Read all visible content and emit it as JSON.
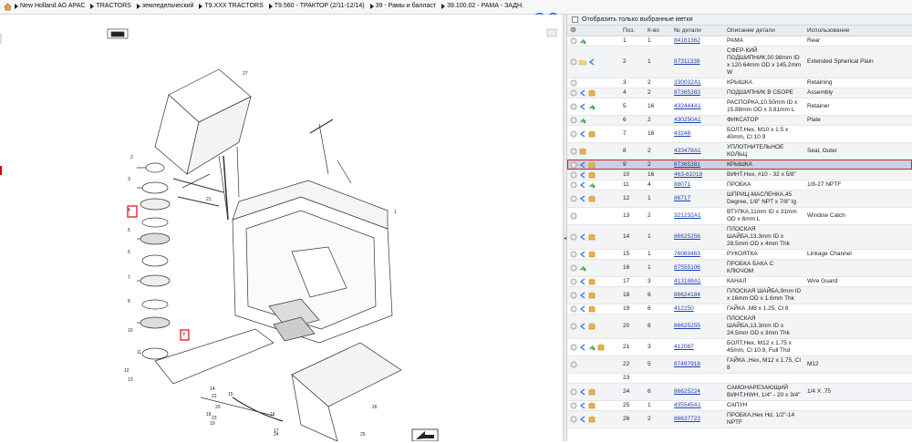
{
  "breadcrumbs": [
    "New Holland AG APAC",
    "TRACTORS",
    "земледельческий",
    "T9.XXX TRACTORS",
    "T9.560 - ТРАКТОР (2/11-12/14)",
    "39 - Рамы и балласт",
    "39.100.02 - РАМА - ЗАДН."
  ],
  "filter_label": "Отобразить только выбранные метки",
  "columns": {
    "pos": "Поз.",
    "qty": "К-во",
    "part": "№ детали",
    "desc": "Описание детали",
    "usage": "Использование"
  },
  "rows": [
    {
      "pos": "1",
      "qty": "1",
      "part": "84181362",
      "desc": "РАМА",
      "usage": "Rear",
      "icons": [
        "circle",
        "arrow"
      ]
    },
    {
      "pos": "2",
      "qty": "1",
      "part": "87311338",
      "desc": "СФЕР-КИЙ ПОДШИПНИК,50.98mm ID x 120.64mm OD x 145.2mm W",
      "usage": "Extended Spherical Plain",
      "icons": [
        "circle",
        "folder",
        "swap"
      ]
    },
    {
      "pos": "3",
      "qty": "2",
      "part": "330032A1",
      "desc": "КРЫШКА",
      "usage": "Retaining",
      "icons": [
        "circle"
      ]
    },
    {
      "pos": "4",
      "qty": "2",
      "part": "87365383",
      "desc": "ПОДШИПНИК В СБОРЕ",
      "usage": "Assembly",
      "icons": [
        "circle",
        "swap",
        "box"
      ]
    },
    {
      "pos": "5",
      "qty": "16",
      "part": "432444A1",
      "desc": "РАСПОРКА,10.50mm ID x 15.88mm OD x 3.81mm L",
      "usage": "Retainer",
      "icons": [
        "circle",
        "swap",
        "arrow"
      ]
    },
    {
      "pos": "6",
      "qty": "2",
      "part": "430250A1",
      "desc": "ФИКСАТОР",
      "usage": "Plate",
      "icons": [
        "circle",
        "arrow"
      ]
    },
    {
      "pos": "7",
      "qty": "16",
      "part": "43248",
      "desc": "БОЛТ,Hex, M10 x 1.5 x 40mm, Cl 10.9",
      "usage": "",
      "icons": [
        "circle",
        "swap",
        "box"
      ]
    },
    {
      "pos": "8",
      "qty": "2",
      "part": "433478A1",
      "desc": "УПЛОТНИТЕЛЬНОЕ КОЛЬЦ",
      "usage": "Seal, Outer",
      "icons": [
        "circle",
        "box"
      ]
    },
    {
      "pos": "9",
      "qty": "2",
      "part": "87365381",
      "desc": "КРЫШКА",
      "usage": "",
      "icons": [
        "circle",
        "swap",
        "box"
      ],
      "selected": true
    },
    {
      "pos": "10",
      "qty": "16",
      "part": "463-61018",
      "desc": "ВИНТ,Hex, #10 - 32 x 5/8\"",
      "usage": "",
      "icons": [
        "circle",
        "swap",
        "box"
      ]
    },
    {
      "pos": "11",
      "qty": "4",
      "part": "88071",
      "desc": "ПРОБКА",
      "usage": "1/8-27 NPTF",
      "icons": [
        "circle",
        "swap",
        "arrow"
      ]
    },
    {
      "pos": "12",
      "qty": "1",
      "part": "86717",
      "desc": "ШПРИЦ-МАСЛЕНКА,45 Degree, 1/8\" NPT x 7/8\" lg",
      "usage": "",
      "icons": [
        "circle",
        "swap",
        "box"
      ]
    },
    {
      "pos": "13",
      "qty": "2",
      "part": "321232A1",
      "desc": "ВТУЛКА,11mm ID x 31mm OD x 6mm L",
      "usage": "Window Catch",
      "icons": [
        "circle"
      ]
    },
    {
      "pos": "14",
      "qty": "1",
      "part": "86625256",
      "desc": "ПЛОСКАЯ ШАЙБА,13.3mm ID x 28.5mm OD x 4mm Thk",
      "usage": "",
      "icons": [
        "circle",
        "swap",
        "box"
      ]
    },
    {
      "pos": "15",
      "qty": "1",
      "part": "76083463",
      "desc": "РУКОЯТКА",
      "usage": "Linkage Channel",
      "icons": [
        "circle",
        "swap",
        "box"
      ]
    },
    {
      "pos": "16",
      "qty": "1",
      "part": "87555106",
      "desc": "ПРОБКА БАКА С КЛЮЧОМ",
      "usage": "",
      "icons": [
        "circle",
        "arrow"
      ]
    },
    {
      "pos": "17",
      "qty": "3",
      "part": "413188A1",
      "desc": "КАНАЛ",
      "usage": "Wire Guard",
      "icons": [
        "circle",
        "swap",
        "box"
      ]
    },
    {
      "pos": "18",
      "qty": "6",
      "part": "86624184",
      "desc": "ПЛОСКАЯ ШАЙБА,9mm ID x 16mm OD x 1.6mm Thk",
      "usage": "",
      "icons": [
        "circle",
        "swap",
        "box"
      ]
    },
    {
      "pos": "19",
      "qty": "6",
      "part": "412250",
      "desc": "ГАЙКА ,M8 x 1.25, Cl 8",
      "usage": "",
      "icons": [
        "circle",
        "swap",
        "box"
      ]
    },
    {
      "pos": "20",
      "qty": "8",
      "part": "86625255",
      "desc": "ПЛОСКАЯ ШАЙБА,13.3mm ID x 24.5mm OD x 3mm Thk",
      "usage": "",
      "icons": [
        "circle",
        "swap",
        "box"
      ]
    },
    {
      "pos": "21",
      "qty": "3",
      "part": "412087",
      "desc": "БОЛТ,Hex, M12 x 1.75 x 45mm, Cl 10.9, Full Thd",
      "usage": "",
      "icons": [
        "circle",
        "swap",
        "arrow",
        "box"
      ]
    },
    {
      "pos": "22",
      "qty": "5",
      "part": "87497918",
      "desc": "ГАЙКА ,Hex, M12 x 1.75, Cl 8",
      "usage": "M12",
      "icons": [
        "circle"
      ]
    },
    {
      "pos": "23",
      "qty": "",
      "part": "",
      "desc": "",
      "usage": "",
      "icons": []
    },
    {
      "pos": "24",
      "qty": "6",
      "part": "86625224",
      "desc": "САМОНАРЕЗАЮЩИЙ ВИНТ,HWH, 1/4\" - 20 x 3/4\"",
      "usage": "1/4 X .75",
      "icons": [
        "circle",
        "swap",
        "box"
      ]
    },
    {
      "pos": "25",
      "qty": "1",
      "part": "435545A1",
      "desc": "САПУН",
      "usage": "",
      "icons": [
        "circle",
        "swap",
        "box"
      ]
    },
    {
      "pos": "26",
      "qty": "2",
      "part": "86637723",
      "desc": "ПРОБКА,Hex Hd, 1/2\"-14 NPTF",
      "usage": "",
      "icons": [
        "circle",
        "swap",
        "box"
      ]
    }
  ],
  "callouts": [
    "1",
    "2",
    "3",
    "4",
    "5",
    "6",
    "7",
    "8",
    "9",
    "10",
    "11",
    "12",
    "13",
    "14",
    "15",
    "16",
    "17",
    "18",
    "19",
    "20",
    "21",
    "22",
    "23",
    "24",
    "25",
    "26",
    "27"
  ]
}
